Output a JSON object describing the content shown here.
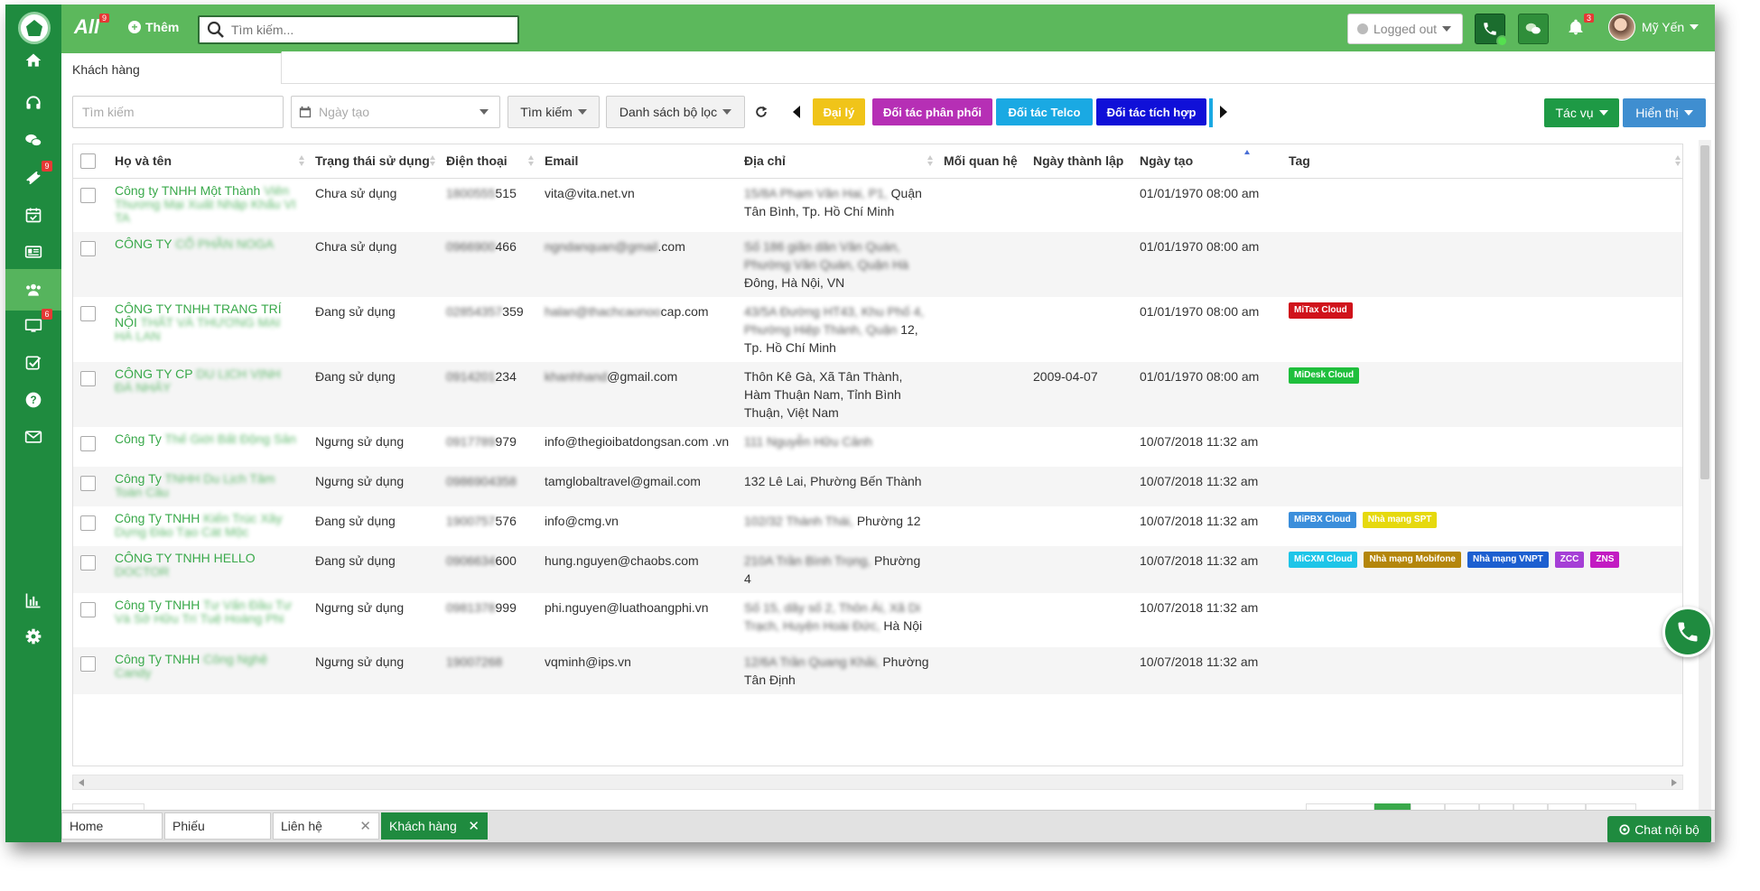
{
  "topbar": {
    "brand": "All",
    "brand_badge": "9",
    "add_label": "Thêm",
    "search_placeholder": "Tìm kiếm...",
    "status": "Logged out",
    "notification_count": "3",
    "user_name": "Mỹ Yến"
  },
  "sidebar": {
    "items": [
      {
        "icon": "home-icon"
      },
      {
        "icon": "headset-icon"
      },
      {
        "icon": "chat-icon"
      },
      {
        "icon": "ticket-icon",
        "badge": "9"
      },
      {
        "icon": "calendar-icon"
      },
      {
        "icon": "id-card-icon"
      },
      {
        "icon": "users-icon",
        "active": true
      },
      {
        "icon": "monitor-icon",
        "badge": "6"
      },
      {
        "icon": "checklist-icon"
      },
      {
        "icon": "help-icon"
      },
      {
        "icon": "mail-icon"
      },
      {
        "icon": "bar-chart-icon"
      },
      {
        "icon": "gear-icon"
      }
    ]
  },
  "page_tab": "Khách hàng",
  "filters": {
    "search_placeholder": "Tìm kiếm",
    "date_placeholder": "Ngày tạo",
    "search_btn": "Tìm kiếm",
    "filter_list_btn": "Danh sách bộ lọc",
    "tag_buttons": [
      {
        "label": "Đại lý",
        "color": "#f0c419"
      },
      {
        "label": "Đối tác phân phối",
        "color": "#b62fb5"
      },
      {
        "label": "Đối tác Telco",
        "color": "#1aa9e3"
      },
      {
        "label": "Đối tác tích hợp",
        "color": "#1010d8"
      }
    ],
    "actions_btn": "Tác vụ",
    "display_btn": "Hiển thị"
  },
  "table": {
    "columns": [
      "Họ và tên",
      "Trạng thái sử dụng",
      "Điện thoại",
      "Email",
      "Địa chỉ",
      "Mối quan hệ",
      "Ngày thành lập",
      "Ngày tạo",
      "Tag"
    ],
    "rows": [
      {
        "name_visible": "Công ty TNHH Một Thành",
        "name_hidden": "Viên Thương Mại Xuất Nhập Khẩu VI TA",
        "status": "Chưa sử dụng",
        "phone_hidden": "1800555",
        "phone_visible": "515",
        "email_visible": "vita@vita.net.vn",
        "email_hidden": "",
        "addr_hidden": "15/8A Phạm Văn Hai, P1,",
        "addr_visible": "Quận Tân Bình, Tp. Hồ Chí Minh",
        "relation": "",
        "founded": "",
        "created": "01/01/1970 08:00 am",
        "tags": []
      },
      {
        "name_visible": "CÔNG TY",
        "name_hidden": "CỔ PHẦN NOGA",
        "status": "Chưa sử dụng",
        "phone_hidden": "0966900",
        "phone_visible": "466",
        "email_visible": ".com",
        "email_hidden": "ngndanquan@gmail",
        "addr_hidden": "Số 186 giãn dân Văn Quán, Phường Văn Quán, Quận Hà",
        "addr_visible": "Đông, Hà Nội, VN",
        "relation": "",
        "founded": "",
        "created": "01/01/1970 08:00 am",
        "tags": []
      },
      {
        "name_visible": "CÔNG TY TNHH TRANG TRÍ NỘI",
        "name_hidden": "THẤT VÀ THƯƠNG MẠI HÀ LAN",
        "status": "Đang sử dụng",
        "phone_hidden": "02854357",
        "phone_visible": "359",
        "email_visible": "cap.com",
        "email_hidden": "halan@thachcaonoo",
        "addr_hidden": "43/5A Đường HT43, Khu Phố 4, Phường Hiệp Thành, Quận",
        "addr_visible": "12, Tp. Hồ Chí Minh",
        "relation": "",
        "founded": "",
        "created": "01/01/1970 08:00 am",
        "tags": [
          {
            "label": "MiTax Cloud",
            "color": "#d0131b"
          }
        ]
      },
      {
        "name_visible": "CÔNG TY CP",
        "name_hidden": "DU LỊCH VỊNH ĐÁ NHẢY",
        "status": "Đang sử dụng",
        "phone_hidden": "0914201",
        "phone_visible": "234",
        "email_visible": "@gmail.com",
        "email_hidden": "khanhhand",
        "addr_hidden": "",
        "addr_visible": "Thôn Kê Gà, Xã Tân Thành, Hàm Thuận Nam, Tỉnh Bình Thuận, Việt Nam",
        "relation": "",
        "founded": "2009-04-07",
        "created": "01/01/1970 08:00 am",
        "tags": [
          {
            "label": "MiDesk Cloud",
            "color": "#1fbf3c"
          }
        ]
      },
      {
        "name_visible": "Công Ty",
        "name_hidden": "Thế Giới Bất Động Sản",
        "status": "Ngưng sử dụng",
        "phone_hidden": "0917789",
        "phone_visible": "979",
        "email_visible": "info@thegioibatdongsan.com .vn",
        "email_hidden": "",
        "addr_hidden": "111 Nguyễn Hữu Cảnh",
        "addr_visible": "",
        "relation": "",
        "founded": "",
        "created": "10/07/2018 11:32 am",
        "tags": []
      },
      {
        "name_visible": "Công Ty",
        "name_hidden": "TNHH Du Lịch Tâm Toàn Cầu",
        "status": "Ngưng sử dụng",
        "phone_hidden": "0986904358",
        "phone_visible": "",
        "email_visible": "tamglobaltravel@gmail.com",
        "email_hidden": "",
        "addr_hidden": "",
        "addr_visible": "132 Lê Lai, Phường Bến Thành",
        "relation": "",
        "founded": "",
        "created": "10/07/2018 11:32 am",
        "tags": []
      },
      {
        "name_visible": "Công Ty TNHH",
        "name_hidden": "Kiến Trúc Xây Dựng Đào Tạo Cát Mộc",
        "status": "Đang sử dụng",
        "phone_hidden": "1900757",
        "phone_visible": "576",
        "email_visible": "info@cmg.vn",
        "email_hidden": "",
        "addr_hidden": "102/32 Thành Thái,",
        "addr_visible": "Phường 12",
        "relation": "",
        "founded": "",
        "created": "10/07/2018 11:32 am",
        "tags": [
          {
            "label": "MiPBX Cloud",
            "color": "#3b8edb"
          },
          {
            "label": "Nhà mạng SPT",
            "color": "#e6d90e"
          }
        ]
      },
      {
        "name_visible": "CÔNG TY TNHH HELLO",
        "name_hidden": "DOCTOR",
        "status": "Đang sử dụng",
        "phone_hidden": "0906634",
        "phone_visible": "600",
        "email_visible": "hung.nguyen@chaobs.com",
        "email_hidden": "",
        "addr_hidden": "210A Trần Bình Trọng,",
        "addr_visible": "Phường 4",
        "relation": "",
        "founded": "",
        "created": "10/07/2018 11:32 am",
        "tags": [
          {
            "label": "MiCXM Cloud",
            "color": "#1ec5e8"
          },
          {
            "label": "Nhà mạng Mobifone",
            "color": "#b4860b"
          },
          {
            "label": "Nhà mạng VNPT",
            "color": "#1c5fd0"
          },
          {
            "label": "ZCC",
            "color": "#a53fd6"
          },
          {
            "label": "ZNS",
            "color": "#c21bc2"
          }
        ]
      },
      {
        "name_visible": "Công Ty TNHH",
        "name_hidden": "Tư Vấn Đầu Tư Và Sở Hữu Trí Tuệ Hoàng Phi",
        "status": "Ngưng sử dụng",
        "phone_hidden": "0981378",
        "phone_visible": "999",
        "email_visible": "phi.nguyen@luathoangphi.vn",
        "email_hidden": "",
        "addr_hidden": "Số 15, dãy số 2, Thôn Ái, Xã Di Trạch, Huyện Hoài Đức,",
        "addr_visible": "Hà Nội",
        "relation": "",
        "founded": "",
        "created": "10/07/2018 11:32 am",
        "tags": []
      },
      {
        "name_visible": "Công Ty TNHH",
        "name_hidden": "Công Nghệ Candy",
        "status": "Ngưng sử dụng",
        "phone_hidden": "19007268",
        "phone_visible": "",
        "email_visible": "vqminh@ips.vn",
        "email_hidden": "",
        "addr_hidden": "12/6A Trần Quang Khải,",
        "addr_visible": "Phường Tân Định",
        "relation": "",
        "founded": "",
        "created": "10/07/2018 11:32 am",
        "tags": []
      }
    ]
  },
  "bottom_tabs": [
    {
      "label": "Home",
      "closable": false,
      "active": false
    },
    {
      "label": "Phiếu",
      "closable": false,
      "active": false
    },
    {
      "label": "Liên hệ",
      "closable": true,
      "active": false
    },
    {
      "label": "Khách hàng",
      "closable": true,
      "active": true
    }
  ],
  "chat_button": "Chat nội bộ"
}
